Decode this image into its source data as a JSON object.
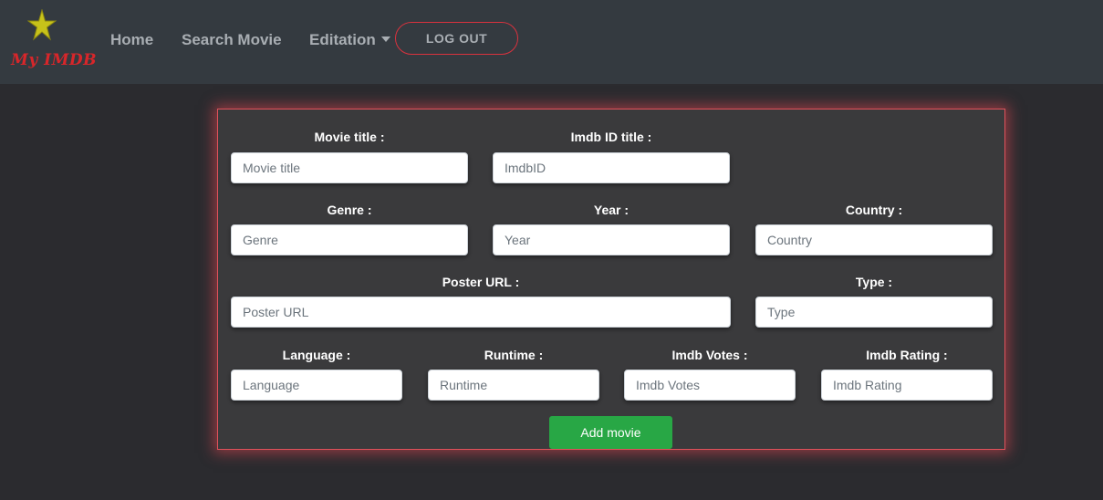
{
  "brand": {
    "logo_text": "My IMDB",
    "star_color": "#c7c21a",
    "text_color": "#d8262a"
  },
  "nav": {
    "home": "Home",
    "search": "Search Movie",
    "editation": "Editation",
    "logout": "LOG OUT"
  },
  "form": {
    "movie_title": {
      "label": "Movie title :",
      "placeholder": "Movie title"
    },
    "imdb_id": {
      "label": "Imdb ID title :",
      "placeholder": "ImdbID"
    },
    "genre": {
      "label": "Genre :",
      "placeholder": "Genre"
    },
    "year": {
      "label": "Year :",
      "placeholder": "Year"
    },
    "country": {
      "label": "Country :",
      "placeholder": "Country"
    },
    "poster_url": {
      "label": "Poster URL :",
      "placeholder": "Poster URL"
    },
    "type": {
      "label": "Type :",
      "placeholder": "Type"
    },
    "language": {
      "label": "Language :",
      "placeholder": "Language"
    },
    "runtime": {
      "label": "Runtime :",
      "placeholder": "Runtime"
    },
    "imdb_votes": {
      "label": "Imdb Votes :",
      "placeholder": "Imdb Votes"
    },
    "imdb_rating": {
      "label": "Imdb Rating :",
      "placeholder": "Imdb Rating"
    },
    "submit": "Add movie"
  },
  "colors": {
    "accent_red": "#e0525b",
    "success": "#28a745",
    "navbar": "#343a40"
  }
}
